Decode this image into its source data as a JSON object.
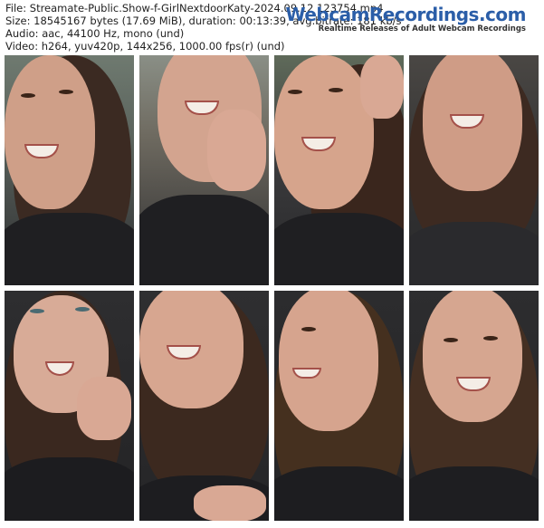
{
  "header": {
    "file": "File: Streamate-Public.Show-f-GirlNextdoorKaty-2024.09.12 123754.mp4",
    "size": "Size: 18545167 bytes (17.69 MiB), duration: 00:13:39, avg.bitrate: 181 kb/s",
    "audio": "Audio: aac, 44100 Hz, mono (und)",
    "video": "Video: h264, yuv420p, 144x256, 1000.00 fps(r) (und)"
  },
  "logo": {
    "main": "WebcamRecordings.com",
    "sub": "Realtime Releases of Adult Webcam Recordings"
  },
  "thumbnails": [
    {
      "name": "frame-1"
    },
    {
      "name": "frame-2"
    },
    {
      "name": "frame-3"
    },
    {
      "name": "frame-4"
    },
    {
      "name": "frame-5"
    },
    {
      "name": "frame-6"
    },
    {
      "name": "frame-7"
    },
    {
      "name": "frame-8"
    }
  ]
}
